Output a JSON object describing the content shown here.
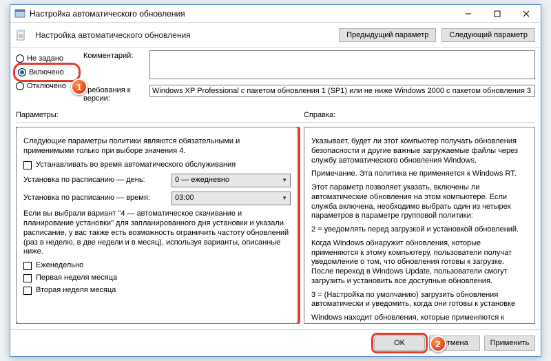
{
  "window": {
    "title": "Настройка автоматического обновления",
    "subtitle": "Настройка автоматического обновления"
  },
  "nav": {
    "prev": "Предыдущий параметр",
    "next": "Следующий параметр"
  },
  "state": {
    "not_configured": "Не задано",
    "enabled": "Включено",
    "disabled": "Отключено"
  },
  "meta": {
    "comment_label": "Комментарий:",
    "comment_value": "",
    "supported_label": "Требования к версии:",
    "supported_value": "Windows XP Professional с пакетом обновления 1 (SP1) или не ниже Windows 2000 с пакетом обновления 3 (SP3)"
  },
  "sections": {
    "options": "Параметры:",
    "help": "Справка:"
  },
  "options": {
    "intro": "Следующие параметры политики являются обязательными и применимыми только при выборе значения 4.",
    "chk_maint": "Устанавливать во время автоматического обслуживания",
    "sched_day_label": "Установка по расписанию — день:",
    "sched_day_value": "0 — ежедневно",
    "sched_time_label": "Установка по расписанию — время:",
    "sched_time_value": "03:00",
    "body4": "Если вы выбрали вариант \"4 — автоматическое скачивание и планирование установки\" для запланированного дня установки и указали расписание, у вас также есть возможность ограничить частоту обновлений (раз в неделю, в две недели и в месяц), используя варианты, описанные ниже.",
    "chk_weekly": "Еженедельно",
    "chk_week1": "Первая неделя месяца",
    "chk_week2": "Вторая неделя месяца"
  },
  "help": {
    "p1": "Указывает, будет ли этот компьютер получать обновления безопасности и другие важные загружаемые файлы через службу автоматического обновления Windows.",
    "p2": "Примечание. Эта политика не применяется к Windows RT.",
    "p3": "Этот параметр позволяет указать, включены ли автоматические обновления на этом компьютере. Если служба включена, необходимо выбрать один из четырех параметров в параметре групповой политики:",
    "p4": "2 = уведомлять перед загрузкой и установкой обновлений.",
    "p5": "Когда Windows обнаружит обновления, которые применяются к этому компьютеру, пользователи получат уведомление о том, что обновления готовы к загрузке. После переход в Windows Update, пользователи смогут загрузить и установить все доступные обновления.",
    "p6": "3 = (Настройка по умолчанию) загрузить обновления автоматически и уведомить, когда они готовы к установке",
    "p7": "Windows находит обновления, которые применяются к компьютеру и загружает их в фоновом режиме (пользователь не уведомляется или прерывается во время этого"
  },
  "footer": {
    "ok": "OK",
    "cancel": "Отмена",
    "apply": "Применить"
  },
  "badges": {
    "b1": "1",
    "b2": "2"
  }
}
